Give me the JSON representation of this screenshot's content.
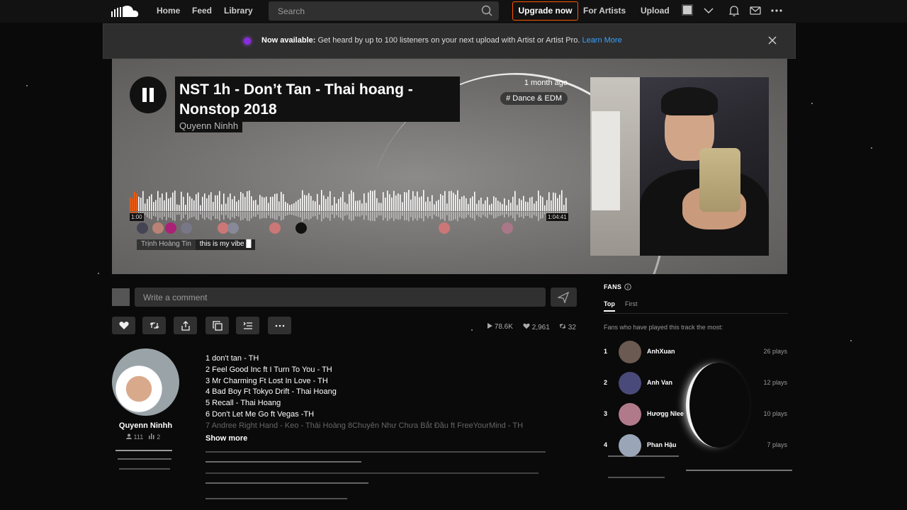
{
  "nav": {
    "home": "Home",
    "feed": "Feed",
    "library": "Library",
    "search_placeholder": "Search",
    "upgrade": "Upgrade now",
    "for_artists": "For Artists",
    "upload": "Upload"
  },
  "banner": {
    "bold": "Now available:",
    "text": " Get heard by up to 100 listeners on your next upload with Artist or Artist Pro. ",
    "link": "Learn More"
  },
  "track": {
    "title": "NST 1h - Don’t Tan - Thai hoang - Nonstop 2018",
    "artist": "Quyenn Ninhh",
    "posted": "1 month ago",
    "genre": "# Dance & EDM",
    "time_current": "1:00",
    "time_total": "1:04:41",
    "comment_user": "Trịnh Hoàng Tin",
    "comment_text": "this is my vibe █"
  },
  "comment": {
    "placeholder": "Write a comment"
  },
  "stats": {
    "plays": "78.6K",
    "likes": "2,961",
    "reposts": "32"
  },
  "uploader": {
    "name": "Quyenn Ninhh",
    "followers": "111",
    "tracks": "2"
  },
  "tracklist": [
    "1 don't tan - TH",
    "2 Feel Good Inc ft I Turn To You - TH",
    "3 Mr Charming Ft Lost In Love - TH",
    "4 Bad Boy Ft Tokyo Drift - Thai Hoang",
    "5 Recall - Thai Hoang",
    "6 Don't Let Me Go ft Vegas -TH",
    "7 Andree Right Hand - Keo - Thái Hoàng 8Chuyên Như Chưa Bắt Đầu ft FreeYourMind - TH"
  ],
  "show_more": "Show more",
  "fans": {
    "heading": "FANS",
    "tab_top": "Top",
    "tab_first": "First",
    "desc": "Fans who have played this track the most:",
    "list": [
      {
        "rank": "1",
        "name": "AnhXuan",
        "plays": "26 plays",
        "color": "#6b5a52"
      },
      {
        "rank": "2",
        "name": "Anh Van",
        "plays": "12 plays",
        "color": "#4a4a7a"
      },
      {
        "rank": "3",
        "name": "Hươgg Nlee",
        "plays": "10 plays",
        "color": "#b07a8a"
      },
      {
        "rank": "4",
        "name": "Phan Hậu",
        "plays": "7 plays",
        "color": "#9aa6b8"
      }
    ]
  },
  "colors": {
    "accent": "#ff5500",
    "link": "#38a2ff",
    "surface": "#303030"
  }
}
